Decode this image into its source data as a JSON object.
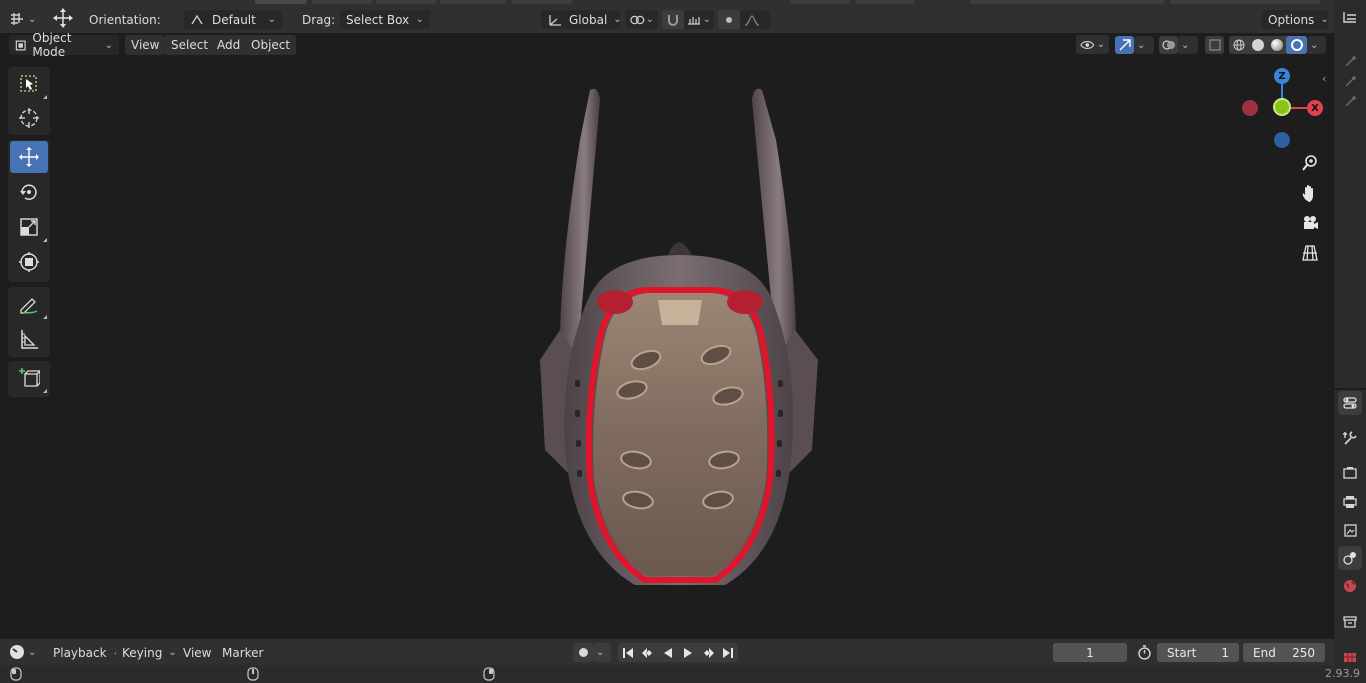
{
  "header": {
    "orientation_label": "Orientation:",
    "orientation_value": "Default",
    "drag_label": "Drag:",
    "drag_value": "Select Box",
    "transform_space": "Global",
    "options_label": "Options"
  },
  "viewport_header": {
    "mode": "Object Mode",
    "menus": [
      "View",
      "Select",
      "Add",
      "Object"
    ]
  },
  "toolbar": {
    "tools": [
      "select-box",
      "cursor",
      "move",
      "rotate",
      "scale",
      "transform",
      "annotate",
      "measure",
      "add-cube"
    ],
    "active_tool": "move"
  },
  "gizmo": {
    "z_label": "Z",
    "x_label": "X"
  },
  "timeline": {
    "menus": [
      "Playback",
      "Keying",
      "View",
      "Marker"
    ],
    "current_frame": "1",
    "start_label": "Start",
    "start_value": "1",
    "end_label": "End",
    "end_value": "250"
  },
  "status": {
    "version": "2.93.9"
  },
  "colors": {
    "accent": "#4772b3",
    "x_axis": "#e0434e",
    "y_axis": "#8ac21b",
    "z_axis": "#3b82d8",
    "helmet_trim": "#e0142a"
  }
}
